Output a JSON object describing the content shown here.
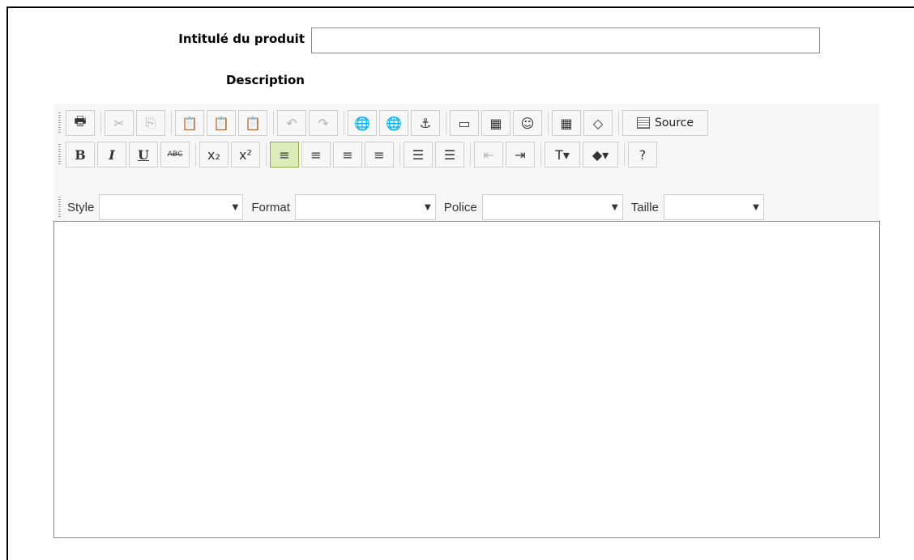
{
  "form": {
    "title_label": "Intitulé du produit",
    "title_value": "",
    "description_label": "Description"
  },
  "toolbar": {
    "row1": [
      {
        "name": "print",
        "icon": "printer-icon",
        "glyph": "🖶",
        "enabled": true
      },
      {
        "name": "cut",
        "icon": "scissors-icon",
        "glyph": "✂",
        "enabled": false
      },
      {
        "name": "copy",
        "icon": "copy-icon",
        "glyph": "⎘",
        "enabled": false
      },
      {
        "name": "paste",
        "icon": "clipboard-icon",
        "glyph": "📋",
        "enabled": true
      },
      {
        "name": "paste-text",
        "icon": "paste-text-icon",
        "glyph": "📋",
        "enabled": true
      },
      {
        "name": "paste-word",
        "icon": "paste-word-icon",
        "glyph": "📋",
        "enabled": true
      },
      {
        "name": "undo",
        "icon": "undo-icon",
        "glyph": "↶",
        "enabled": false
      },
      {
        "name": "redo",
        "icon": "redo-icon",
        "glyph": "↷",
        "enabled": false
      },
      {
        "name": "link",
        "icon": "link-icon",
        "glyph": "🌐",
        "enabled": true
      },
      {
        "name": "unlink",
        "icon": "unlink-icon",
        "glyph": "🌐",
        "enabled": false
      },
      {
        "name": "anchor",
        "icon": "anchor-icon",
        "glyph": "⚓",
        "enabled": true
      },
      {
        "name": "image",
        "icon": "image-icon",
        "glyph": "▭",
        "enabled": true
      },
      {
        "name": "table",
        "icon": "table-icon",
        "glyph": "▦",
        "enabled": true
      },
      {
        "name": "smiley",
        "icon": "smiley-icon",
        "glyph": "☺",
        "enabled": true
      },
      {
        "name": "select-all",
        "icon": "select-all-icon",
        "glyph": "▦",
        "enabled": true
      },
      {
        "name": "remove-format",
        "icon": "eraser-icon",
        "glyph": "◇",
        "enabled": true
      }
    ],
    "source_label": "Source",
    "row2": [
      {
        "name": "bold",
        "icon": "bold-icon",
        "glyph": "B",
        "enabled": true
      },
      {
        "name": "italic",
        "icon": "italic-icon",
        "glyph": "I",
        "enabled": true
      },
      {
        "name": "underline",
        "icon": "underline-icon",
        "glyph": "U",
        "enabled": true
      },
      {
        "name": "strike",
        "icon": "strikethrough-icon",
        "glyph": "ABC",
        "enabled": true
      },
      {
        "name": "subscript",
        "icon": "subscript-icon",
        "glyph": "x₂",
        "enabled": true
      },
      {
        "name": "superscript",
        "icon": "superscript-icon",
        "glyph": "x²",
        "enabled": true
      },
      {
        "name": "align-left",
        "icon": "align-left-icon",
        "glyph": "≡",
        "enabled": true,
        "active": true
      },
      {
        "name": "align-center",
        "icon": "align-center-icon",
        "glyph": "≡",
        "enabled": true
      },
      {
        "name": "align-right",
        "icon": "align-right-icon",
        "glyph": "≡",
        "enabled": true
      },
      {
        "name": "justify",
        "icon": "justify-icon",
        "glyph": "≡",
        "enabled": true
      },
      {
        "name": "ordered-list",
        "icon": "numbered-list-icon",
        "glyph": "☰",
        "enabled": true
      },
      {
        "name": "bullet-list",
        "icon": "bullet-list-icon",
        "glyph": "☰",
        "enabled": true
      },
      {
        "name": "outdent",
        "icon": "outdent-icon",
        "glyph": "⇤",
        "enabled": false
      },
      {
        "name": "indent",
        "icon": "indent-icon",
        "glyph": "⇥",
        "enabled": true
      },
      {
        "name": "text-color",
        "icon": "text-color-icon",
        "glyph": "T▾",
        "enabled": true
      },
      {
        "name": "bg-color",
        "icon": "background-color-icon",
        "glyph": "◆▾",
        "enabled": true
      },
      {
        "name": "help",
        "icon": "help-icon",
        "glyph": "?",
        "enabled": true
      }
    ],
    "combos": [
      {
        "label": "Style",
        "value": ""
      },
      {
        "label": "Format",
        "value": ""
      },
      {
        "label": "Police",
        "value": ""
      },
      {
        "label": "Taille",
        "value": ""
      }
    ]
  },
  "colors": {
    "active_button": "#dcecb8",
    "toolbar_bg": "#f6f6f6"
  }
}
